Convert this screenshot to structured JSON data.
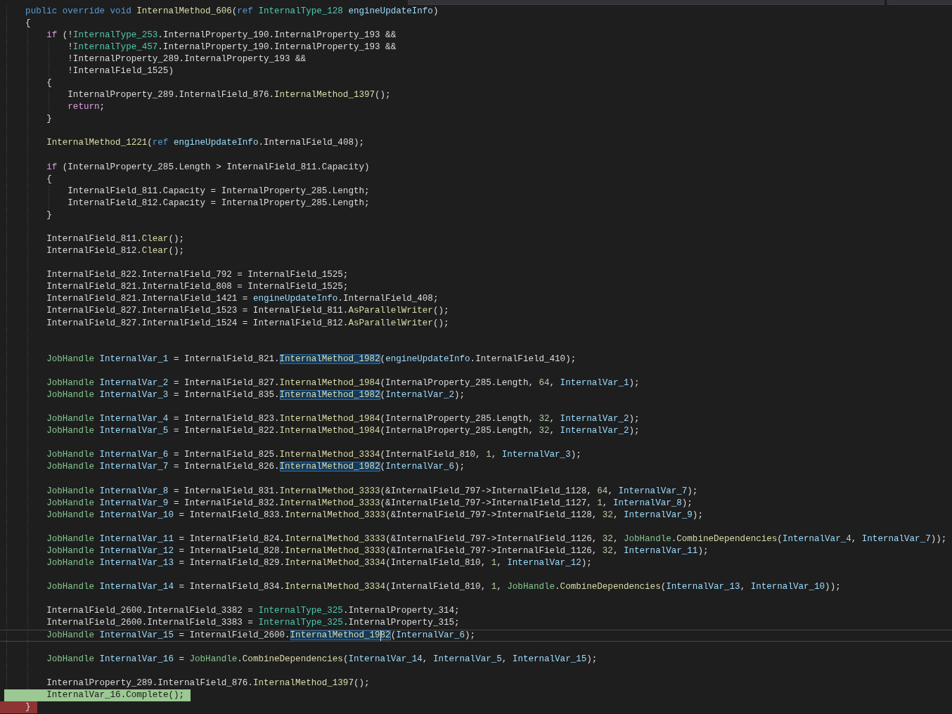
{
  "editor": {
    "lines": [
      {
        "kind": "plain",
        "tokens": [
          {
            "text": "    public override void ",
            "kind": "keyword"
          },
          {
            "text": "InternalMethod_606",
            "kind": "method"
          },
          {
            "text": "(",
            "kind": "plain"
          },
          {
            "text": "ref ",
            "kind": "keyword"
          },
          {
            "text": "InternalType_128 ",
            "kind": "type"
          },
          {
            "text": "engineUpdateInfo",
            "kind": "local"
          },
          {
            "text": ")",
            "kind": "plain"
          }
        ]
      },
      {
        "kind": "plain",
        "tokens": [
          {
            "text": "    {",
            "kind": "plain"
          }
        ]
      },
      {
        "kind": "plain",
        "tokens": [
          {
            "text": "        if ",
            "kind": "control"
          },
          {
            "text": "(!",
            "kind": "plain"
          },
          {
            "text": "InternalType_253",
            "kind": "type"
          },
          {
            "text": ".InternalProperty_190.InternalProperty_193 &&",
            "kind": "plain"
          }
        ]
      },
      {
        "kind": "plain",
        "tokens": [
          {
            "text": "            !",
            "kind": "plain"
          },
          {
            "text": "InternalType_457",
            "kind": "type"
          },
          {
            "text": ".InternalProperty_190.InternalProperty_193 &&",
            "kind": "plain"
          }
        ]
      },
      {
        "kind": "plain",
        "tokens": [
          {
            "text": "            !InternalProperty_289.InternalProperty_193 &&",
            "kind": "plain"
          }
        ]
      },
      {
        "kind": "plain",
        "tokens": [
          {
            "text": "            !InternalField_1525)",
            "kind": "plain"
          }
        ]
      },
      {
        "kind": "plain",
        "tokens": [
          {
            "text": "        {",
            "kind": "plain"
          }
        ]
      },
      {
        "kind": "plain",
        "tokens": [
          {
            "text": "            InternalProperty_289.InternalField_876.",
            "kind": "plain"
          },
          {
            "text": "InternalMethod_1397",
            "kind": "method"
          },
          {
            "text": "();",
            "kind": "plain"
          }
        ]
      },
      {
        "kind": "plain",
        "tokens": [
          {
            "text": "            return",
            "kind": "control"
          },
          {
            "text": ";",
            "kind": "plain"
          }
        ]
      },
      {
        "kind": "plain",
        "tokens": [
          {
            "text": "        }",
            "kind": "plain"
          }
        ]
      },
      {
        "kind": "blank"
      },
      {
        "kind": "plain",
        "tokens": [
          {
            "text": "        InternalMethod_1221",
            "kind": "method"
          },
          {
            "text": "(",
            "kind": "plain"
          },
          {
            "text": "ref ",
            "kind": "keyword"
          },
          {
            "text": "engineUpdateInfo",
            "kind": "local"
          },
          {
            "text": ".InternalField_408);",
            "kind": "plain"
          }
        ]
      },
      {
        "kind": "blank"
      },
      {
        "kind": "plain",
        "tokens": [
          {
            "text": "        if ",
            "kind": "control"
          },
          {
            "text": "(InternalProperty_285.Length > InternalField_811.Capacity)",
            "kind": "plain"
          }
        ]
      },
      {
        "kind": "plain",
        "tokens": [
          {
            "text": "        {",
            "kind": "plain"
          }
        ]
      },
      {
        "kind": "plain",
        "tokens": [
          {
            "text": "            InternalField_811.Capacity = InternalProperty_285.Length;",
            "kind": "plain"
          }
        ]
      },
      {
        "kind": "plain",
        "tokens": [
          {
            "text": "            InternalField_812.Capacity = InternalProperty_285.Length;",
            "kind": "plain"
          }
        ]
      },
      {
        "kind": "plain",
        "tokens": [
          {
            "text": "        }",
            "kind": "plain"
          }
        ]
      },
      {
        "kind": "blank"
      },
      {
        "kind": "plain",
        "tokens": [
          {
            "text": "        InternalField_811.",
            "kind": "plain"
          },
          {
            "text": "Clear",
            "kind": "method"
          },
          {
            "text": "();",
            "kind": "plain"
          }
        ]
      },
      {
        "kind": "plain",
        "tokens": [
          {
            "text": "        InternalField_812.",
            "kind": "plain"
          },
          {
            "text": "Clear",
            "kind": "method"
          },
          {
            "text": "();",
            "kind": "plain"
          }
        ]
      },
      {
        "kind": "blank"
      },
      {
        "kind": "plain",
        "tokens": [
          {
            "text": "        InternalField_822.InternalField_792 = InternalField_1525;",
            "kind": "plain"
          }
        ]
      },
      {
        "kind": "plain",
        "tokens": [
          {
            "text": "        InternalField_821.InternalField_808 = InternalField_1525;",
            "kind": "plain"
          }
        ]
      },
      {
        "kind": "plain",
        "tokens": [
          {
            "text": "        InternalField_821.InternalField_1421 = ",
            "kind": "plain"
          },
          {
            "text": "engineUpdateInfo",
            "kind": "local"
          },
          {
            "text": ".InternalField_408;",
            "kind": "plain"
          }
        ]
      },
      {
        "kind": "plain",
        "tokens": [
          {
            "text": "        InternalField_827.InternalField_1523 = InternalField_811.",
            "kind": "plain"
          },
          {
            "text": "AsParallelWriter",
            "kind": "method"
          },
          {
            "text": "();",
            "kind": "plain"
          }
        ]
      },
      {
        "kind": "plain",
        "tokens": [
          {
            "text": "        InternalField_827.InternalField_1524 = InternalField_812.",
            "kind": "plain"
          },
          {
            "text": "AsParallelWriter",
            "kind": "method"
          },
          {
            "text": "();",
            "kind": "plain"
          }
        ]
      },
      {
        "kind": "blank"
      },
      {
        "kind": "blank"
      },
      {
        "kind": "plain",
        "tokens": [
          {
            "text": "        JobHandle ",
            "kind": "struct"
          },
          {
            "text": "InternalVar_1",
            "kind": "local"
          },
          {
            "text": " = InternalField_821.",
            "kind": "plain"
          },
          {
            "text": "InternalMethod_1982",
            "kind": "match"
          },
          {
            "text": "(",
            "kind": "plain"
          },
          {
            "text": "engineUpdateInfo",
            "kind": "local"
          },
          {
            "text": ".InternalField_410);",
            "kind": "plain"
          }
        ]
      },
      {
        "kind": "blank"
      },
      {
        "kind": "plain",
        "tokens": [
          {
            "text": "        JobHandle ",
            "kind": "struct"
          },
          {
            "text": "InternalVar_2",
            "kind": "local"
          },
          {
            "text": " = InternalField_827.",
            "kind": "plain"
          },
          {
            "text": "InternalMethod_1984",
            "kind": "method"
          },
          {
            "text": "(InternalProperty_285.Length, ",
            "kind": "plain"
          },
          {
            "text": "64",
            "kind": "number"
          },
          {
            "text": ", ",
            "kind": "plain"
          },
          {
            "text": "InternalVar_1",
            "kind": "local"
          },
          {
            "text": ");",
            "kind": "plain"
          }
        ]
      },
      {
        "kind": "plain",
        "tokens": [
          {
            "text": "        JobHandle ",
            "kind": "struct"
          },
          {
            "text": "InternalVar_3",
            "kind": "local"
          },
          {
            "text": " = InternalField_835.",
            "kind": "plain"
          },
          {
            "text": "InternalMethod_1982",
            "kind": "match"
          },
          {
            "text": "(",
            "kind": "plain"
          },
          {
            "text": "InternalVar_2",
            "kind": "local"
          },
          {
            "text": ");",
            "kind": "plain"
          }
        ]
      },
      {
        "kind": "blank"
      },
      {
        "kind": "plain",
        "tokens": [
          {
            "text": "        JobHandle ",
            "kind": "struct"
          },
          {
            "text": "InternalVar_4",
            "kind": "local"
          },
          {
            "text": " = InternalField_823.",
            "kind": "plain"
          },
          {
            "text": "InternalMethod_1984",
            "kind": "method"
          },
          {
            "text": "(InternalProperty_285.Length, ",
            "kind": "plain"
          },
          {
            "text": "32",
            "kind": "number"
          },
          {
            "text": ", ",
            "kind": "plain"
          },
          {
            "text": "InternalVar_2",
            "kind": "local"
          },
          {
            "text": ");",
            "kind": "plain"
          }
        ]
      },
      {
        "kind": "plain",
        "tokens": [
          {
            "text": "        JobHandle ",
            "kind": "struct"
          },
          {
            "text": "InternalVar_5",
            "kind": "local"
          },
          {
            "text": " = InternalField_822.",
            "kind": "plain"
          },
          {
            "text": "InternalMethod_1984",
            "kind": "method"
          },
          {
            "text": "(InternalProperty_285.Length, ",
            "kind": "plain"
          },
          {
            "text": "32",
            "kind": "number"
          },
          {
            "text": ", ",
            "kind": "plain"
          },
          {
            "text": "InternalVar_2",
            "kind": "local"
          },
          {
            "text": ");",
            "kind": "plain"
          }
        ]
      },
      {
        "kind": "blank"
      },
      {
        "kind": "plain",
        "tokens": [
          {
            "text": "        JobHandle ",
            "kind": "struct"
          },
          {
            "text": "InternalVar_6",
            "kind": "local"
          },
          {
            "text": " = InternalField_825.",
            "kind": "plain"
          },
          {
            "text": "InternalMethod_3334",
            "kind": "method"
          },
          {
            "text": "(InternalField_810, ",
            "kind": "plain"
          },
          {
            "text": "1",
            "kind": "number"
          },
          {
            "text": ", ",
            "kind": "plain"
          },
          {
            "text": "InternalVar_3",
            "kind": "local"
          },
          {
            "text": ");",
            "kind": "plain"
          }
        ]
      },
      {
        "kind": "plain",
        "tokens": [
          {
            "text": "        JobHandle ",
            "kind": "struct"
          },
          {
            "text": "InternalVar_7",
            "kind": "local"
          },
          {
            "text": " = InternalField_826.",
            "kind": "plain"
          },
          {
            "text": "InternalMethod_1982",
            "kind": "match"
          },
          {
            "text": "(",
            "kind": "plain"
          },
          {
            "text": "InternalVar_6",
            "kind": "local"
          },
          {
            "text": ");",
            "kind": "plain"
          }
        ]
      },
      {
        "kind": "blank"
      },
      {
        "kind": "plain",
        "tokens": [
          {
            "text": "        JobHandle ",
            "kind": "struct"
          },
          {
            "text": "InternalVar_8",
            "kind": "local"
          },
          {
            "text": " = InternalField_831.",
            "kind": "plain"
          },
          {
            "text": "InternalMethod_3333",
            "kind": "method"
          },
          {
            "text": "(&InternalField_797->InternalField_1128, ",
            "kind": "plain"
          },
          {
            "text": "64",
            "kind": "number"
          },
          {
            "text": ", ",
            "kind": "plain"
          },
          {
            "text": "InternalVar_7",
            "kind": "local"
          },
          {
            "text": ");",
            "kind": "plain"
          }
        ]
      },
      {
        "kind": "plain",
        "tokens": [
          {
            "text": "        JobHandle ",
            "kind": "struct"
          },
          {
            "text": "InternalVar_9",
            "kind": "local"
          },
          {
            "text": " = InternalField_832.",
            "kind": "plain"
          },
          {
            "text": "InternalMethod_3333",
            "kind": "method"
          },
          {
            "text": "(&InternalField_797->InternalField_1127, ",
            "kind": "plain"
          },
          {
            "text": "1",
            "kind": "number"
          },
          {
            "text": ", ",
            "kind": "plain"
          },
          {
            "text": "InternalVar_8",
            "kind": "local"
          },
          {
            "text": ");",
            "kind": "plain"
          }
        ]
      },
      {
        "kind": "plain",
        "tokens": [
          {
            "text": "        JobHandle ",
            "kind": "struct"
          },
          {
            "text": "InternalVar_10",
            "kind": "local"
          },
          {
            "text": " = InternalField_833.",
            "kind": "plain"
          },
          {
            "text": "InternalMethod_3333",
            "kind": "method"
          },
          {
            "text": "(&InternalField_797->InternalField_1128, ",
            "kind": "plain"
          },
          {
            "text": "32",
            "kind": "number"
          },
          {
            "text": ", ",
            "kind": "plain"
          },
          {
            "text": "InternalVar_9",
            "kind": "local"
          },
          {
            "text": ");",
            "kind": "plain"
          }
        ]
      },
      {
        "kind": "blank"
      },
      {
        "kind": "plain",
        "tokens": [
          {
            "text": "        JobHandle ",
            "kind": "struct"
          },
          {
            "text": "InternalVar_11",
            "kind": "local"
          },
          {
            "text": " = InternalField_824.",
            "kind": "plain"
          },
          {
            "text": "InternalMethod_3333",
            "kind": "method"
          },
          {
            "text": "(&InternalField_797->InternalField_1126, ",
            "kind": "plain"
          },
          {
            "text": "32",
            "kind": "number"
          },
          {
            "text": ", ",
            "kind": "plain"
          },
          {
            "text": "JobHandle",
            "kind": "struct"
          },
          {
            "text": ".",
            "kind": "plain"
          },
          {
            "text": "CombineDependencies",
            "kind": "method"
          },
          {
            "text": "(",
            "kind": "plain"
          },
          {
            "text": "InternalVar_4",
            "kind": "local"
          },
          {
            "text": ", ",
            "kind": "plain"
          },
          {
            "text": "InternalVar_7",
            "kind": "local"
          },
          {
            "text": "));",
            "kind": "plain"
          }
        ]
      },
      {
        "kind": "plain",
        "tokens": [
          {
            "text": "        JobHandle ",
            "kind": "struct"
          },
          {
            "text": "InternalVar_12",
            "kind": "local"
          },
          {
            "text": " = InternalField_828.",
            "kind": "plain"
          },
          {
            "text": "InternalMethod_3333",
            "kind": "method"
          },
          {
            "text": "(&InternalField_797->InternalField_1126, ",
            "kind": "plain"
          },
          {
            "text": "32",
            "kind": "number"
          },
          {
            "text": ", ",
            "kind": "plain"
          },
          {
            "text": "InternalVar_11",
            "kind": "local"
          },
          {
            "text": ");",
            "kind": "plain"
          }
        ]
      },
      {
        "kind": "plain",
        "tokens": [
          {
            "text": "        JobHandle ",
            "kind": "struct"
          },
          {
            "text": "InternalVar_13",
            "kind": "local"
          },
          {
            "text": " = InternalField_829.",
            "kind": "plain"
          },
          {
            "text": "InternalMethod_3334",
            "kind": "method"
          },
          {
            "text": "(InternalField_810, ",
            "kind": "plain"
          },
          {
            "text": "1",
            "kind": "number"
          },
          {
            "text": ", ",
            "kind": "plain"
          },
          {
            "text": "InternalVar_12",
            "kind": "local"
          },
          {
            "text": ");",
            "kind": "plain"
          }
        ]
      },
      {
        "kind": "blank"
      },
      {
        "kind": "plain",
        "tokens": [
          {
            "text": "        JobHandle ",
            "kind": "struct"
          },
          {
            "text": "InternalVar_14",
            "kind": "local"
          },
          {
            "text": " = InternalField_834.",
            "kind": "plain"
          },
          {
            "text": "InternalMethod_3334",
            "kind": "method"
          },
          {
            "text": "(InternalField_810, ",
            "kind": "plain"
          },
          {
            "text": "1",
            "kind": "number"
          },
          {
            "text": ", ",
            "kind": "plain"
          },
          {
            "text": "JobHandle",
            "kind": "struct"
          },
          {
            "text": ".",
            "kind": "plain"
          },
          {
            "text": "CombineDependencies",
            "kind": "method"
          },
          {
            "text": "(",
            "kind": "plain"
          },
          {
            "text": "InternalVar_13",
            "kind": "local"
          },
          {
            "text": ", ",
            "kind": "plain"
          },
          {
            "text": "InternalVar_10",
            "kind": "local"
          },
          {
            "text": "));",
            "kind": "plain"
          }
        ]
      },
      {
        "kind": "blank"
      },
      {
        "kind": "plain",
        "tokens": [
          {
            "text": "        InternalField_2600.InternalField_3382 = ",
            "kind": "plain"
          },
          {
            "text": "InternalType_325",
            "kind": "type"
          },
          {
            "text": ".InternalProperty_314;",
            "kind": "plain"
          }
        ]
      },
      {
        "kind": "plain",
        "tokens": [
          {
            "text": "        InternalField_2600.InternalField_3383 = ",
            "kind": "plain"
          },
          {
            "text": "InternalType_325",
            "kind": "type"
          },
          {
            "text": ".InternalProperty_315;",
            "kind": "plain"
          }
        ]
      },
      {
        "kind": "current",
        "tokens": [
          {
            "text": "        JobHandle ",
            "kind": "struct"
          },
          {
            "text": "InternalVar_15",
            "kind": "local"
          },
          {
            "text": " = InternalField_2600.",
            "kind": "plain"
          },
          {
            "text": "InternalMethod_19",
            "kind": "match"
          },
          {
            "kind": "caret"
          },
          {
            "text": "82",
            "kind": "match"
          },
          {
            "text": "(",
            "kind": "plain"
          },
          {
            "text": "InternalVar_6",
            "kind": "local"
          },
          {
            "text": ");",
            "kind": "plain"
          }
        ]
      },
      {
        "kind": "blank"
      },
      {
        "kind": "plain",
        "tokens": [
          {
            "text": "        JobHandle ",
            "kind": "struct"
          },
          {
            "text": "InternalVar_16",
            "kind": "local"
          },
          {
            "text": " = ",
            "kind": "plain"
          },
          {
            "text": "JobHandle",
            "kind": "struct"
          },
          {
            "text": ".",
            "kind": "plain"
          },
          {
            "text": "CombineDependencies",
            "kind": "method"
          },
          {
            "text": "(",
            "kind": "plain"
          },
          {
            "text": "InternalVar_14",
            "kind": "local"
          },
          {
            "text": ", ",
            "kind": "plain"
          },
          {
            "text": "InternalVar_5",
            "kind": "local"
          },
          {
            "text": ", ",
            "kind": "plain"
          },
          {
            "text": "InternalVar_15",
            "kind": "local"
          },
          {
            "text": ");",
            "kind": "plain"
          }
        ]
      },
      {
        "kind": "blank"
      },
      {
        "kind": "plain",
        "tokens": [
          {
            "text": "        InternalProperty_289.InternalField_876.",
            "kind": "plain"
          },
          {
            "text": "InternalMethod_1397",
            "kind": "method"
          },
          {
            "text": "();",
            "kind": "plain"
          }
        ]
      },
      {
        "kind": "active",
        "tokens": [
          {
            "text": "        InternalVar_16.Complete();",
            "kind": "plain"
          }
        ]
      },
      {
        "kind": "breakpoint",
        "tokens": [
          {
            "text": "    }",
            "kind": "plain"
          }
        ]
      }
    ]
  }
}
